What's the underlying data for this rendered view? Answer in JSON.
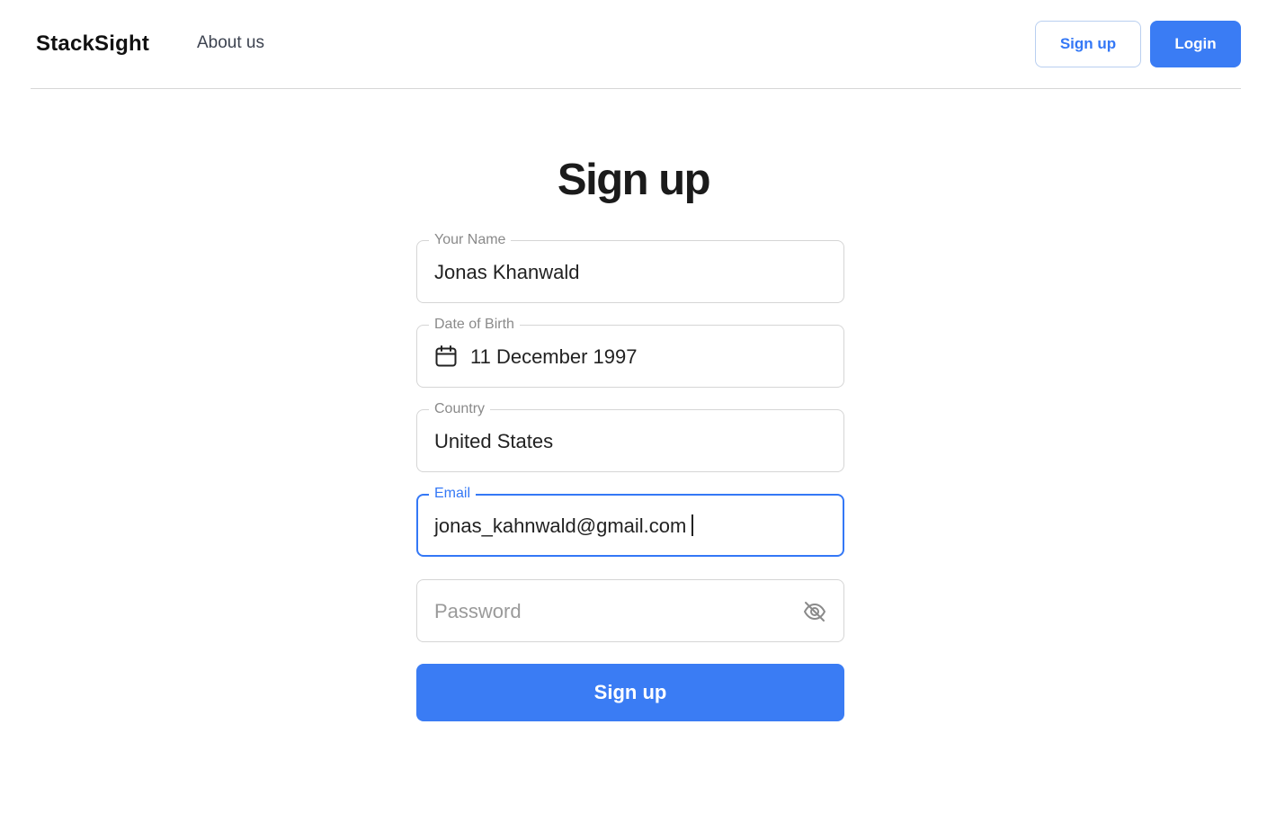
{
  "nav": {
    "logo": "StackSight",
    "about_link": "About us",
    "signup_label": "Sign up",
    "login_label": "Login"
  },
  "form": {
    "title": "Sign up",
    "name": {
      "label": "Your Name",
      "value": "Jonas Khanwald"
    },
    "dob": {
      "label": "Date of Birth",
      "value": "11 December 1997",
      "icon": "calendar-icon"
    },
    "country": {
      "label": "Country",
      "value": "United States"
    },
    "email": {
      "label": "Email",
      "value": "jonas_kahnwald@gmail.com",
      "focused": true
    },
    "password": {
      "placeholder": "Password",
      "icon": "eye-off-icon"
    },
    "submit_label": "Sign up"
  },
  "colors": {
    "accent": "#3a7cf4",
    "focus_border": "#3478f6",
    "field_border": "#d5d5d5"
  }
}
